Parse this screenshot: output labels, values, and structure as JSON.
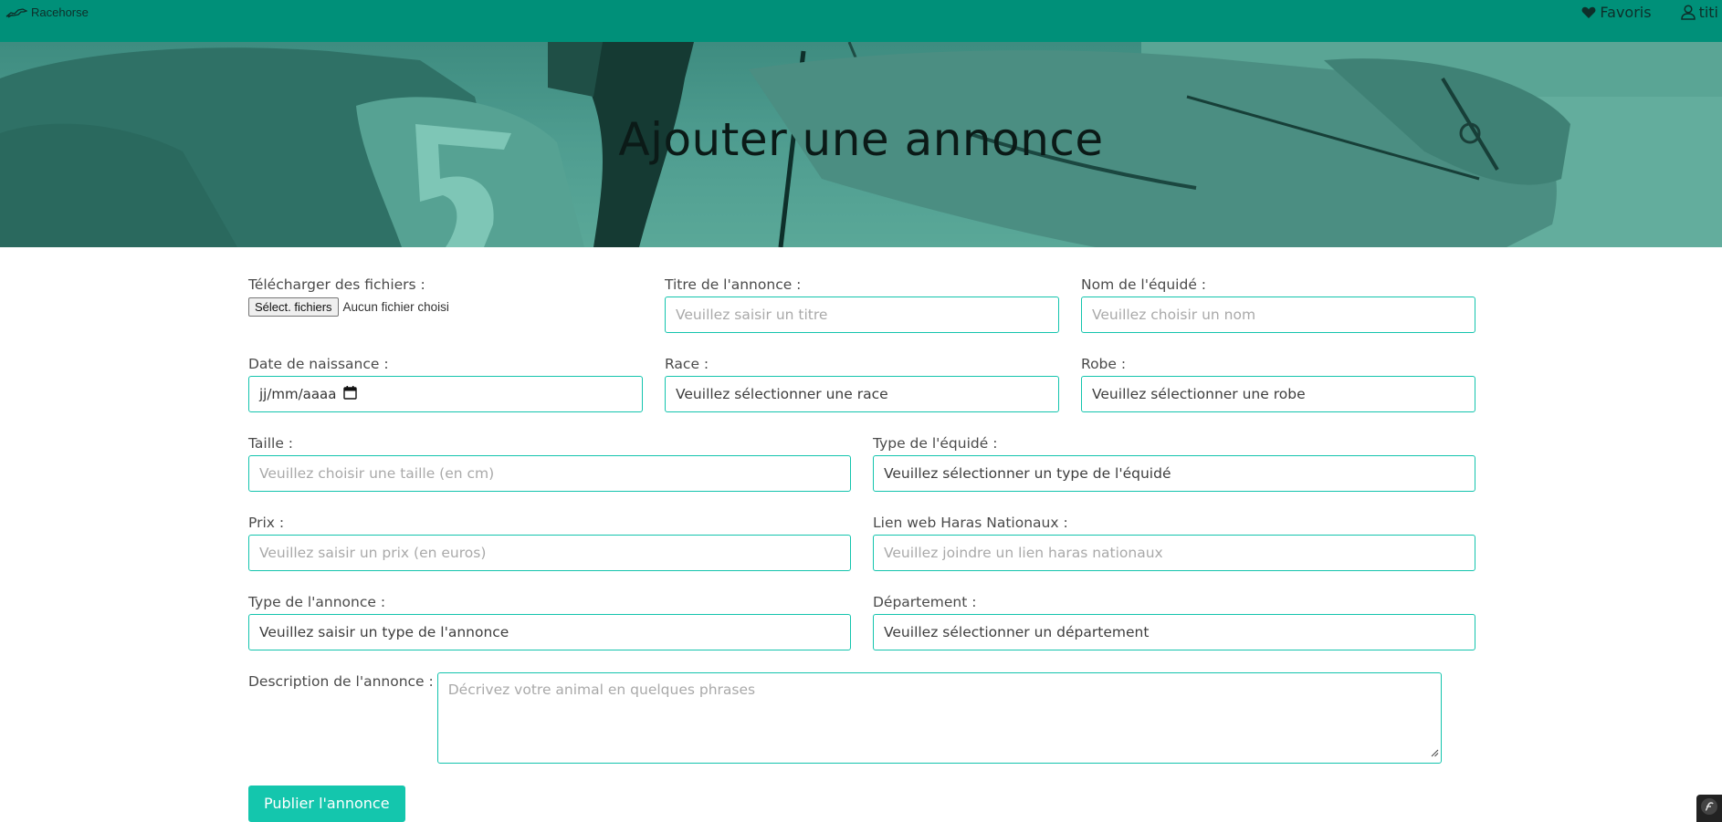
{
  "navbar": {
    "brand": "Racehorse",
    "favoris": "Favoris",
    "user": "titi"
  },
  "hero": {
    "title": "Ajouter une annonce"
  },
  "form": {
    "files": {
      "label": "Télécharger des fichiers :",
      "button": "Sélect. fichiers",
      "status": "Aucun fichier choisi"
    },
    "titre": {
      "label": "Titre de l'annonce :",
      "placeholder": "Veuillez saisir un titre"
    },
    "nom": {
      "label": "Nom de l'équidé :",
      "placeholder": "Veuillez choisir un nom"
    },
    "naissance": {
      "label": "Date de naissance :",
      "value": "jj/mm/aaaa"
    },
    "race": {
      "label": "Race :",
      "value": "Veuillez sélectionner une race"
    },
    "robe": {
      "label": "Robe :",
      "value": "Veuillez sélectionner une robe"
    },
    "taille": {
      "label": "Taille :",
      "placeholder": "Veuillez choisir une taille (en cm)"
    },
    "type_equide": {
      "label": "Type de l'équidé :",
      "value": "Veuillez sélectionner un type de l'équidé"
    },
    "prix": {
      "label": "Prix :",
      "placeholder": "Veuillez saisir un prix (en euros)"
    },
    "lien": {
      "label": "Lien web Haras Nationaux :",
      "placeholder": "Veuillez joindre un lien haras nationaux"
    },
    "type_annonce": {
      "label": "Type de l'annonce :",
      "value": "Veuillez saisir un type de l'annonce"
    },
    "departement": {
      "label": "Département :",
      "value": "Veuillez sélectionner un département"
    },
    "description": {
      "label": "Description de l'annonce :",
      "placeholder": "Décrivez votre animal en quelques phrases"
    },
    "submit": "Publier l'annonce"
  },
  "colors": {
    "navbar": "#009079",
    "accent": "#14c6ad",
    "input_border": "#13c4ad"
  },
  "icons": {
    "brand": "horse-logo-icon",
    "favoris": "heart-icon",
    "user": "user-icon",
    "date": "calendar-icon",
    "symfony": "symfony-icon"
  }
}
